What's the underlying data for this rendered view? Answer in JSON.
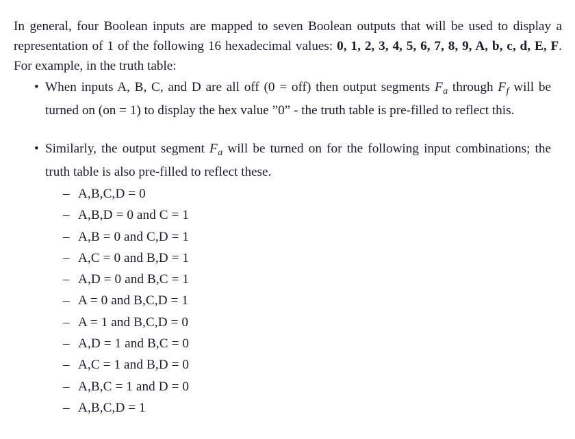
{
  "document": {
    "intro": {
      "text_before_hex": "In general, four Boolean inputs are mapped to seven Boolean outputs that will be used to display a representation of 1 of the following 16 hexadecimal values: ",
      "hex_values": "0, 1, 2, 3, 4, 5, 6, 7, 8, 9, A, b, c, d, E, F",
      "text_after_hex": ". For example, in the truth table:"
    },
    "bullets": [
      {
        "marker": "•",
        "segments": [
          {
            "type": "text",
            "value": "When inputs A, B, C, and D are all off (0 = off) then output segments "
          },
          {
            "type": "math",
            "base": "F",
            "sub": "a"
          },
          {
            "type": "text",
            "value": " through "
          },
          {
            "type": "math",
            "base": "F",
            "sub": "f"
          },
          {
            "type": "text",
            "value": " will be turned on (on = 1) to display the hex value ”0” - the truth table is pre-filled to reflect this."
          }
        ]
      },
      {
        "marker": "•",
        "segments": [
          {
            "type": "text",
            "value": "Similarly, the output segment "
          },
          {
            "type": "math",
            "base": "F",
            "sub": "a"
          },
          {
            "type": "text",
            "value": " will be turned on for the following input combinations; the truth table is also pre-filled to reflect these."
          }
        ]
      }
    ],
    "combination_list": {
      "marker": "–",
      "items": [
        "A,B,C,D = 0",
        "A,B,D = 0 and C = 1",
        "A,B = 0 and C,D = 1",
        "A,C = 0 and B,D = 1",
        "A,D = 0 and B,C = 1",
        "A = 0 and B,C,D = 1",
        "A = 1 and B,C,D = 0",
        "A,D = 1 and B,C = 0",
        "A,C = 1 and B,D = 0",
        "A,B,C = 1 and D = 0",
        "A,B,C,D = 1"
      ]
    },
    "colors": {
      "background": "#ffffff",
      "text": "#1b1b2f"
    }
  }
}
